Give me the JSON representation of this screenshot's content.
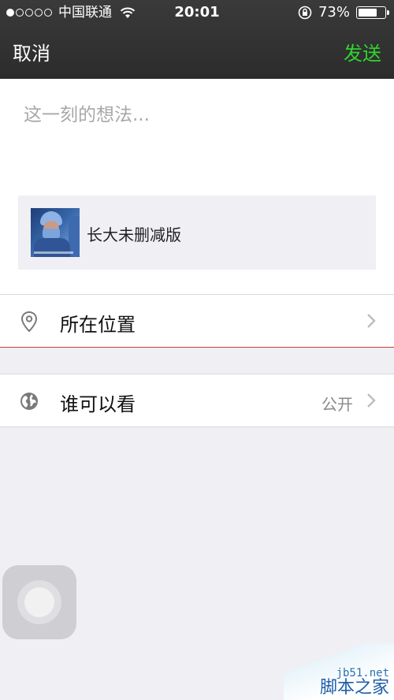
{
  "status_bar": {
    "carrier": "中国联通",
    "time": "20:01",
    "battery_percent": "73%",
    "battery_level": 0.73,
    "signal_bars": 1,
    "signal_total": 5
  },
  "nav": {
    "cancel_label": "取消",
    "send_label": "发送",
    "send_color": "#2ed62e"
  },
  "compose": {
    "placeholder": "这一刻的想法..."
  },
  "shared_item": {
    "title": "长大未删减版"
  },
  "location_row": {
    "label": "所在位置",
    "icon": "location-pin-icon"
  },
  "visibility_row": {
    "label": "谁可以看",
    "value": "公开",
    "icon": "globe-icon"
  },
  "watermark": {
    "site": "jb51.net",
    "brand": "脚本之家"
  }
}
